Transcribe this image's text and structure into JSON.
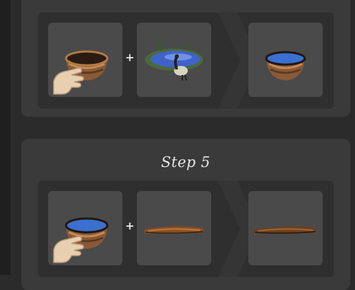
{
  "steps": [
    {
      "title": "",
      "ingredients": [
        {
          "icon": "empty-nest-bowl-icon",
          "action": "hand-click-icon"
        },
        {
          "icon": "goose-pond-icon"
        }
      ],
      "result": {
        "icon": "water-filled-bowl-icon"
      },
      "plus": "+"
    },
    {
      "title": "Step 5",
      "ingredients": [
        {
          "icon": "water-filled-bowl-icon",
          "action": "hand-click-icon"
        },
        {
          "icon": "twig-icon"
        }
      ],
      "result": {
        "icon": "wet-twig-icon"
      },
      "plus": "+"
    }
  ],
  "colors": {
    "background": "#2b2b2b",
    "card": "#3a3a3a",
    "row": "#2f2f2f",
    "slot": "#4a4a4a",
    "arrow": "#353535"
  }
}
